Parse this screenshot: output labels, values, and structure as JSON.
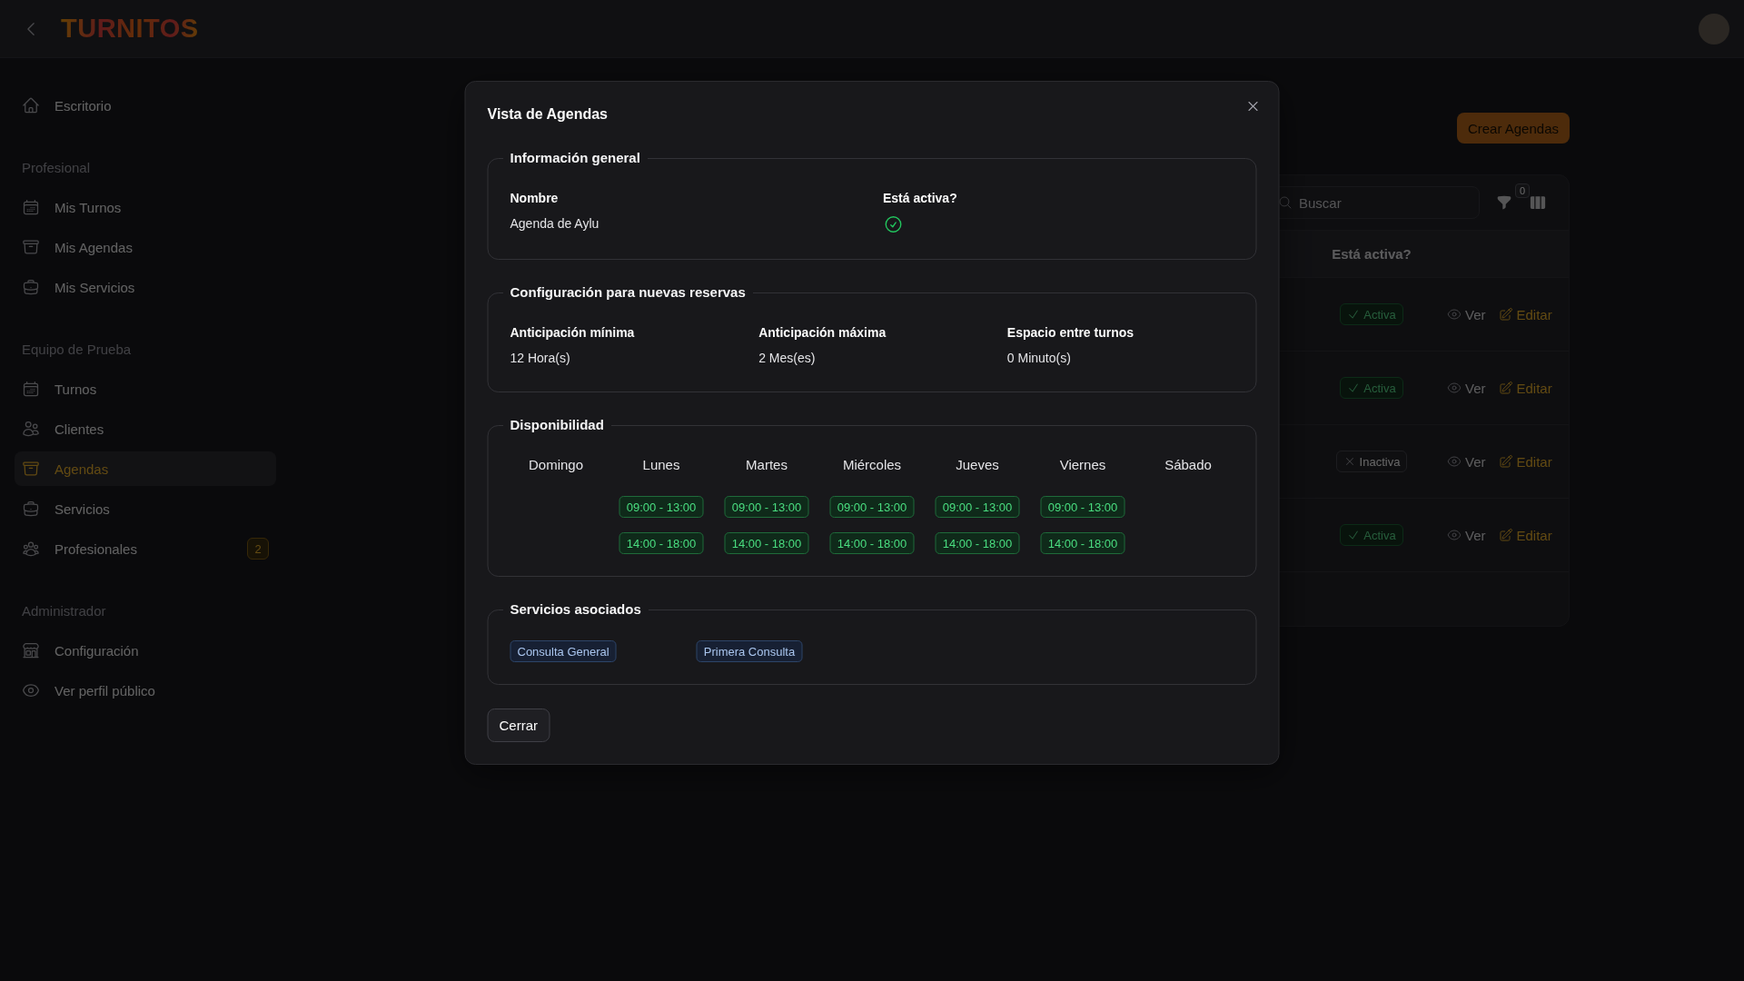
{
  "topbar": {
    "logo": "TURNITOS"
  },
  "sidebar": {
    "sections": [
      {
        "items": [
          {
            "label": "Escritorio",
            "kind": "home",
            "selected": false
          }
        ]
      },
      {
        "heading": "Profesional",
        "items": [
          {
            "label": "Mis Turnos",
            "kind": "calendar",
            "selected": false
          },
          {
            "label": "Mis Agendas",
            "kind": "archive",
            "selected": false
          },
          {
            "label": "Mis Servicios",
            "kind": "briefcase",
            "selected": false
          }
        ]
      },
      {
        "heading": "Equipo de Prueba",
        "items": [
          {
            "label": "Turnos",
            "kind": "calendar",
            "selected": false
          },
          {
            "label": "Clientes",
            "kind": "users",
            "selected": false
          },
          {
            "label": "Agendas",
            "kind": "archive",
            "selected": true
          },
          {
            "label": "Servicios",
            "kind": "briefcase",
            "selected": false
          },
          {
            "label": "Profesionales",
            "kind": "team",
            "selected": false,
            "badge": "2"
          }
        ]
      },
      {
        "heading": "Administrador",
        "items": [
          {
            "label": "Configuración",
            "kind": "store",
            "selected": false
          },
          {
            "label": "Ver perfil público",
            "kind": "eye",
            "selected": false
          }
        ]
      }
    ]
  },
  "page": {
    "create_button": "Crear Agendas",
    "search": {
      "placeholder": "Buscar"
    },
    "filter_count": "0",
    "table": {
      "columns": [
        "Está activa?"
      ],
      "rows": [
        {
          "status": "Activa",
          "active": true,
          "actions": [
            {
              "label": "Ver",
              "kind": "view"
            },
            {
              "label": "Editar",
              "kind": "edit"
            }
          ]
        },
        {
          "status": "Activa",
          "active": true,
          "actions": [
            {
              "label": "Ver",
              "kind": "view"
            },
            {
              "label": "Editar",
              "kind": "edit"
            }
          ]
        },
        {
          "status": "Inactiva",
          "active": false,
          "actions": [
            {
              "label": "Ver",
              "kind": "view"
            },
            {
              "label": "Editar",
              "kind": "edit"
            }
          ]
        },
        {
          "status": "Activa",
          "active": true,
          "actions": [
            {
              "label": "Ver",
              "kind": "view"
            },
            {
              "label": "Editar",
              "kind": "edit"
            }
          ]
        }
      ]
    }
  },
  "modal": {
    "title": "Vista de Agendas",
    "general": {
      "legend": "Información general",
      "name": {
        "label": "Nombre",
        "value": "Agenda de Aylu"
      },
      "active": {
        "label": "Está activa?",
        "on": true
      }
    },
    "booking": {
      "legend": "Configuración para nuevas reservas",
      "fields": [
        {
          "label": "Anticipación mínima",
          "value": "12 Hora(s)"
        },
        {
          "label": "Anticipación máxima",
          "value": "2 Mes(es)"
        },
        {
          "label": "Espacio entre turnos",
          "value": "0 Minuto(s)"
        }
      ]
    },
    "availability": {
      "legend": "Disponibilidad",
      "days": [
        {
          "name": "Domingo"
        },
        {
          "name": "Lunes",
          "slots": [
            "09:00 - 13:00",
            "14:00 - 18:00"
          ]
        },
        {
          "name": "Martes",
          "slots": [
            "09:00 - 13:00",
            "14:00 - 18:00"
          ]
        },
        {
          "name": "Miércoles",
          "slots": [
            "09:00 - 13:00",
            "14:00 - 18:00"
          ]
        },
        {
          "name": "Jueves",
          "slots": [
            "09:00 - 13:00",
            "14:00 - 18:00"
          ]
        },
        {
          "name": "Viernes",
          "slots": [
            "09:00 - 13:00",
            "14:00 - 18:00"
          ]
        },
        {
          "name": "Sábado"
        }
      ]
    },
    "services": {
      "legend": "Servicios asociados",
      "tags": [
        "Consulta General",
        "Primera Consulta"
      ]
    },
    "close_button": "Cerrar"
  }
}
